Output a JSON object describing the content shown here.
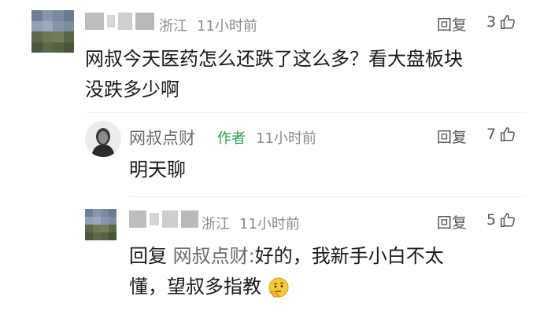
{
  "comments": [
    {
      "location": "浙江",
      "time": "11小时前",
      "reply_label": "回复",
      "likes": "3",
      "text_line1": "网叔今天医药怎么还跌了这么多？看大盘板块",
      "text_line2": "没跌多少啊"
    },
    {
      "author": "网叔点财",
      "author_tag": "作者",
      "time": "11小时前",
      "reply_label": "回复",
      "likes": "7",
      "text": "明天聊"
    },
    {
      "location": "浙江",
      "time": "11小时前",
      "reply_label": "回复",
      "likes": "5",
      "reply_prefix": "回复",
      "reply_to": "网叔点财:",
      "text_line1_rest": "好的，我新手小白不太",
      "text_line2": "懂，望叔多指教"
    }
  ],
  "colors": {
    "author_green": "#2aa14a",
    "meta_gray": "#8a8a8a",
    "name_gray": "#6b6b6b"
  },
  "icons": {
    "like": "thumb-up-icon",
    "emoji": "thinking-face-emoji-icon"
  }
}
